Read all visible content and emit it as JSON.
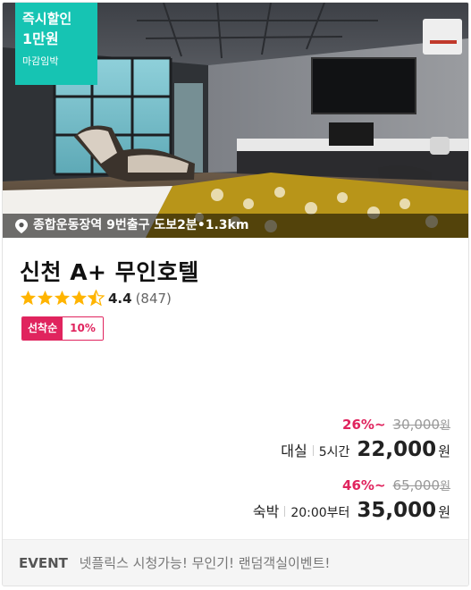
{
  "listing": {
    "promo": {
      "line1": "즉시할인",
      "line2": "1만원",
      "line3": "마감임박",
      "color": "#16c4b3"
    },
    "location": "종합운동장역 9번출구 도보2분•1.3km",
    "title": "신천 A+ 무인호텔",
    "rating": {
      "score": "4.4",
      "count": "(847)",
      "stars_value": 4.4
    },
    "badge": {
      "label": "선착순",
      "value": "10%",
      "color": "#e0245e"
    },
    "prices": [
      {
        "discount": "26%~",
        "original": "30,000",
        "original_unit": "원",
        "type": "대실",
        "duration": "5시간",
        "amount": "22,000",
        "unit": "원"
      },
      {
        "discount": "46%~",
        "original": "65,000",
        "original_unit": "원",
        "type": "숙박",
        "duration": "20:00부터",
        "amount": "35,000",
        "unit": "원"
      }
    ],
    "event": {
      "tag": "EVENT",
      "text": "넷플릭스 시청가능! 무인기! 랜덤객실이벤트!"
    }
  }
}
